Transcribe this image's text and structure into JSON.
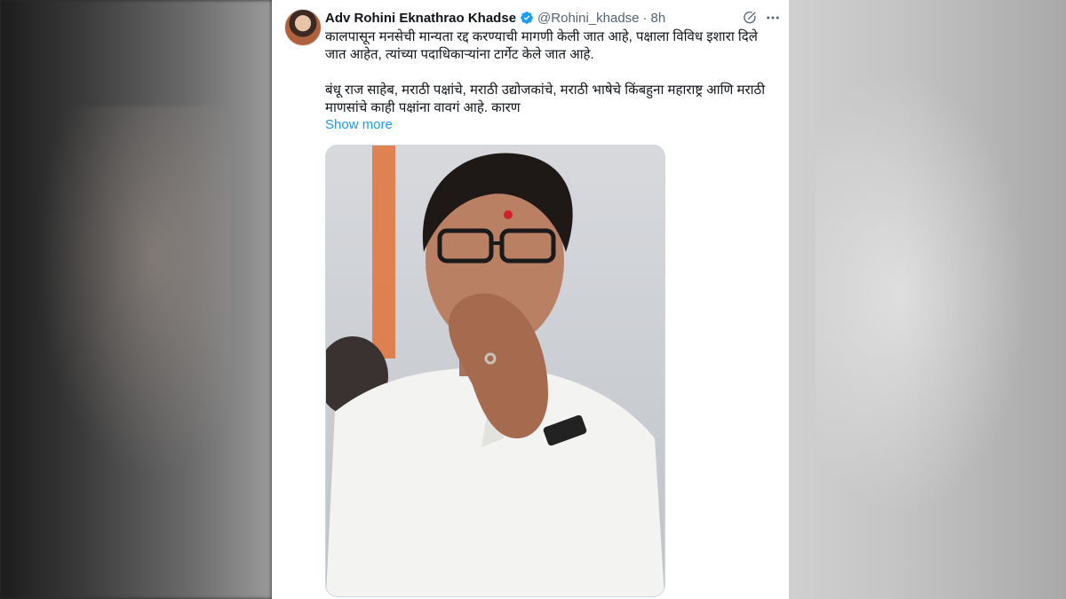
{
  "tweet": {
    "author_name": "Adv Rohini Eknathrao Khadse",
    "handle": "@Rohini_khadse",
    "separator": "·",
    "time": "8h",
    "text": "कालपासून मनसेची मान्यता रद्द करण्याची मागणी केली जात आहे, पक्षाला विविध इशारा दिले जात आहेत, त्यांच्या पदाधिकाऱ्यांना टार्गेट केले जात आहे.\n\nबंधू राज साहेब, मराठी पक्षांचे, मराठी उद्योजकांचे, मराठी भाषेचे किंबहुना महाराष्ट्र आणि मराठी माणसांचे काही पक्षांना वावगं आहे. कारण",
    "show_more_label": "Show more"
  },
  "icons": {
    "verified": "verified-badge-icon",
    "grok": "grok-icon",
    "more": "more-icon"
  },
  "colors": {
    "link": "#1d9bf0",
    "text": "#0f1419",
    "muted": "#536471"
  }
}
